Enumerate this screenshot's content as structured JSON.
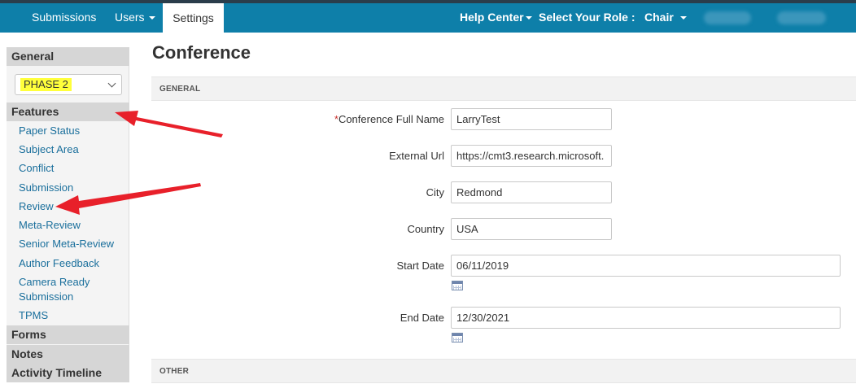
{
  "nav": {
    "submissions": "Submissions",
    "users": "Users",
    "settings": "Settings",
    "help_center": "Help Center",
    "role_label": "Select Your Role :",
    "role_value": "Chair"
  },
  "sidebar": {
    "general_heading": "General",
    "phase_value": "PHASE 2",
    "features_heading": "Features",
    "feature_items": [
      "Paper Status",
      "Subject Area",
      "Conflict",
      "Submission",
      "Review",
      "Meta-Review",
      "Senior Meta-Review",
      "Author Feedback",
      "Camera Ready Submission",
      "TPMS"
    ],
    "forms_heading": "Forms",
    "notes_heading": "Notes",
    "activity_heading": "Activity Timeline"
  },
  "main": {
    "title": "Conference",
    "section_general": "GENERAL",
    "section_other": "OTHER",
    "fields": {
      "full_name": {
        "required_mark": "*",
        "label": "Conference Full Name",
        "value": "LarryTest"
      },
      "external_url": {
        "label": "External Url",
        "value": "https://cmt3.research.microsoft."
      },
      "city": {
        "label": "City",
        "value": "Redmond"
      },
      "country": {
        "label": "Country",
        "value": "USA"
      },
      "start_date": {
        "label": "Start Date",
        "value": "06/11/2019"
      },
      "end_date": {
        "label": "End Date",
        "value": "12/30/2021"
      }
    }
  },
  "colors": {
    "topbar": "#0e7fa9",
    "link": "#1a6f9c",
    "highlight": "#ffff3b",
    "annotation_arrow": "#e8202a"
  }
}
